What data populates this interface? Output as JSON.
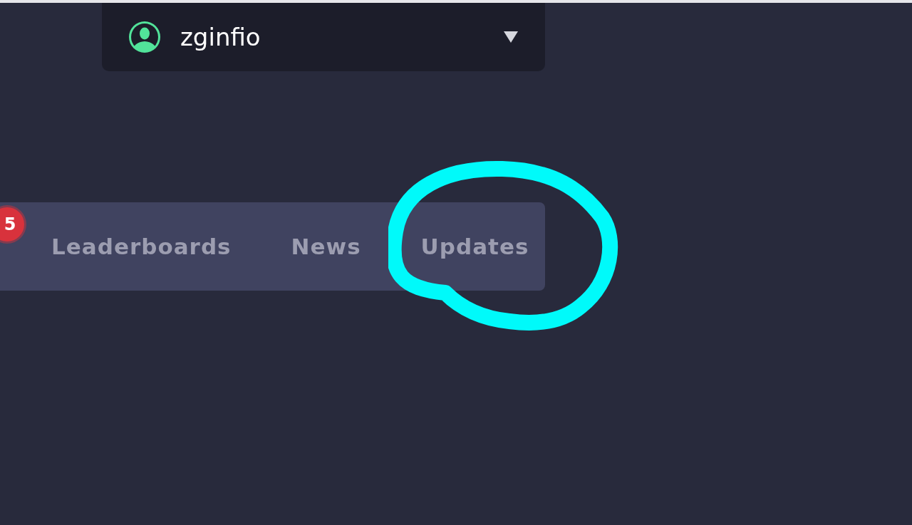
{
  "user_menu": {
    "username": "zginfio"
  },
  "nav": {
    "badge": "5",
    "tabs": [
      {
        "label": "Leaderboards"
      },
      {
        "label": "News"
      },
      {
        "label": "Updates"
      }
    ]
  }
}
